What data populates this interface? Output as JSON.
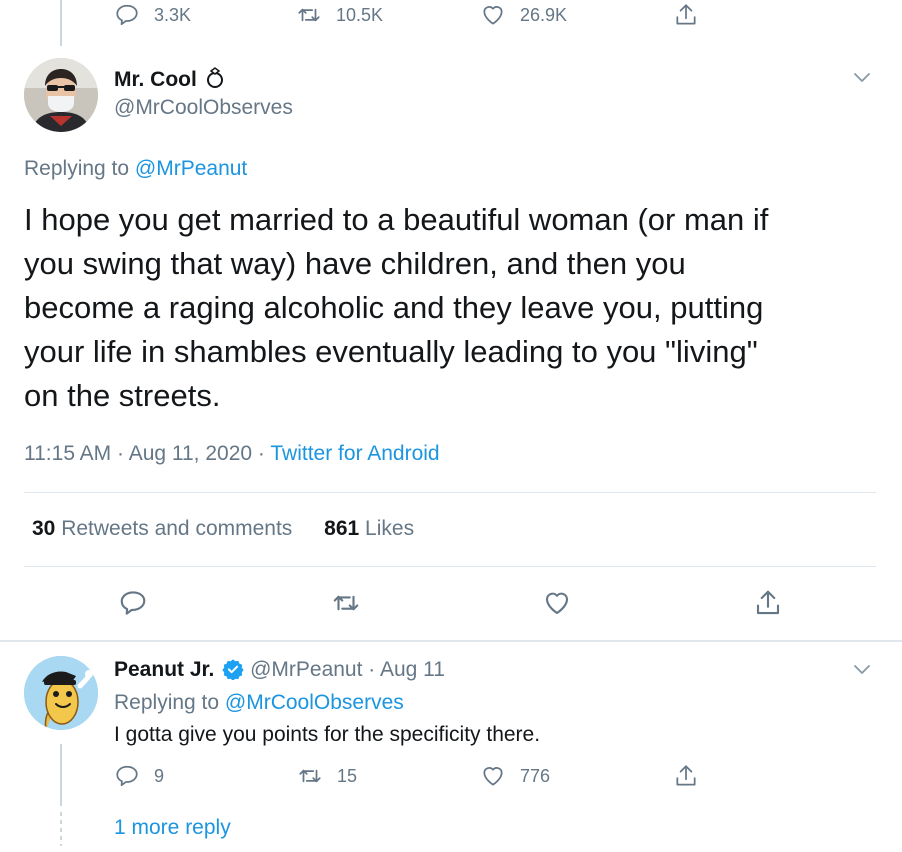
{
  "previous_tweet": {
    "replies": "3.3K",
    "retweets": "10.5K",
    "likes": "26.9K"
  },
  "main_tweet": {
    "author_name": "Mr. Cool",
    "author_handle": "@MrCoolObserves",
    "replying_prefix": "Replying to",
    "replying_to": "@MrPeanut",
    "text_lines": [
      "I hope you get married to a beautiful woman (or man if",
      "you swing that way) have children, and then you",
      "become a raging alcoholic and they leave you, putting",
      "your life in shambles eventually leading to you \"living\"",
      "on the streets."
    ],
    "time": "11:15 AM",
    "date": "Aug 11, 2020",
    "source": "Twitter for Android",
    "retweets_count": "30",
    "retweets_label": "Retweets and comments",
    "likes_count": "861",
    "likes_label": "Likes"
  },
  "reply_tweet": {
    "author_name": "Peanut Jr.",
    "author_handle": "@MrPeanut",
    "date": "Aug 11",
    "replying_prefix": "Replying to",
    "replying_to": "@MrCoolObserves",
    "text": "I gotta give you points for the specificity there.",
    "replies": "9",
    "retweets": "15",
    "likes": "776",
    "more_replies": "1 more reply"
  },
  "colors": {
    "link": "#1b95e0",
    "muted": "#657786",
    "verified": "#1da1f2",
    "divider": "#e1e8ed"
  }
}
